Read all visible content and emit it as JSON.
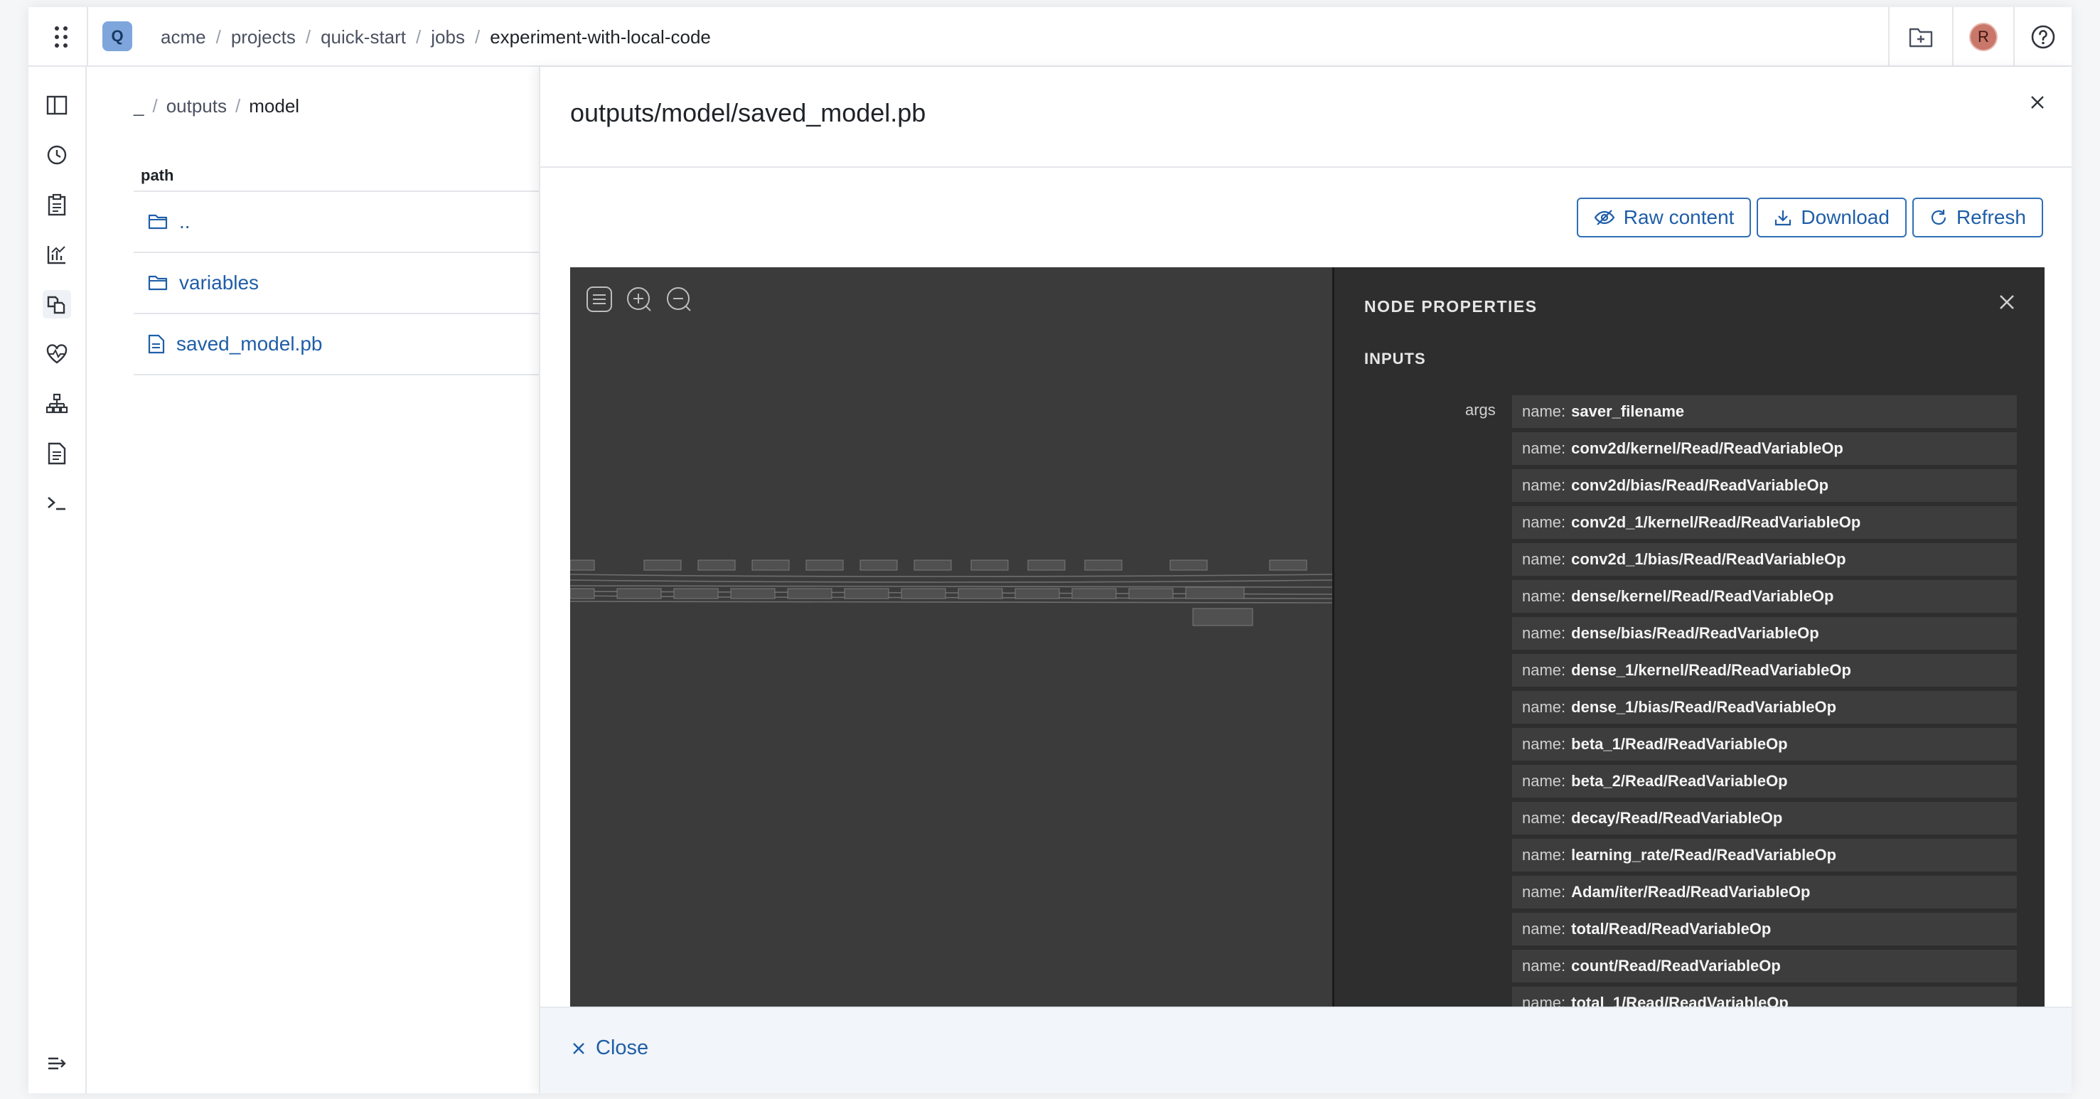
{
  "breadcrumbs": [
    "acme",
    "projects",
    "quick-start",
    "jobs",
    "experiment-with-local-code"
  ],
  "breadcrumb_separator": "/",
  "logo_letter": "Q",
  "avatar_initial": "R",
  "left_panel": {
    "crumbs": [
      "_",
      "outputs",
      "model"
    ],
    "column_header": "path",
    "rows": [
      {
        "name": "..",
        "icon": "folder-icon"
      },
      {
        "name": "variables",
        "icon": "folder-icon"
      },
      {
        "name": "saved_model.pb",
        "icon": "file-icon"
      }
    ]
  },
  "dialog": {
    "title": "outputs/model/saved_model.pb",
    "buttons": {
      "raw": "Raw content",
      "download": "Download",
      "refresh": "Refresh"
    },
    "close_label": "Close"
  },
  "node_properties": {
    "title": "NODE PROPERTIES",
    "section": "INPUTS",
    "args_label": "args",
    "key_label": "name:",
    "args": [
      "saver_filename",
      "conv2d/kernel/Read/ReadVariableOp",
      "conv2d/bias/Read/ReadVariableOp",
      "conv2d_1/kernel/Read/ReadVariableOp",
      "conv2d_1/bias/Read/ReadVariableOp",
      "dense/kernel/Read/ReadVariableOp",
      "dense/bias/Read/ReadVariableOp",
      "dense_1/kernel/Read/ReadVariableOp",
      "dense_1/bias/Read/ReadVariableOp",
      "beta_1/Read/ReadVariableOp",
      "beta_2/Read/ReadVariableOp",
      "decay/Read/ReadVariableOp",
      "learning_rate/Read/ReadVariableOp",
      "Adam/iter/Read/ReadVariableOp",
      "total/Read/ReadVariableOp",
      "count/Read/ReadVariableOp",
      "total_1/Read/ReadVariableOp"
    ]
  },
  "colors": {
    "accent": "#1f5ea8",
    "viewer_bg": "#3b3b3b",
    "props_bg": "#2e2e2e"
  }
}
